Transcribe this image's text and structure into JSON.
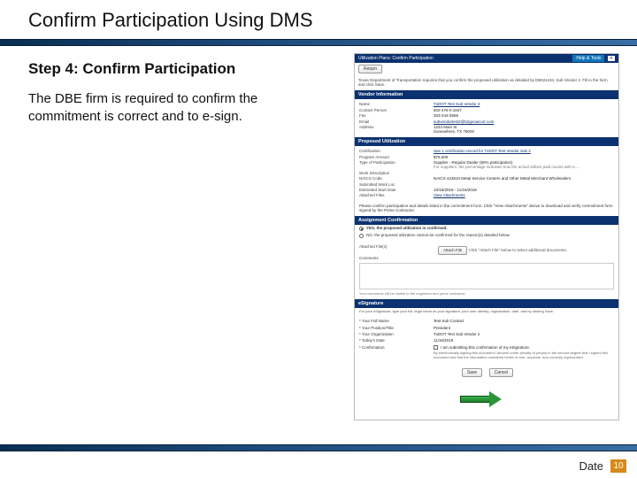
{
  "title": "Confirm Participation Using DMS",
  "step_heading": "Step 4: Confirm Participation",
  "step_body": "The DBE firm is required to confirm the commitment is correct and to e-sign.",
  "footer": {
    "date_label": "Date",
    "page": "10"
  },
  "ss": {
    "top_title": "Utilization Plans: Confirm Participation",
    "help": "Help & Tools",
    "close": "✕",
    "instr": "Texas Department of Transportation requires that you confirm the proposed utilization as detailed by DB021194. Sub Vendor 2. Fill in the form and click Save.",
    "return_btn": "Return",
    "vendor_section": "Vendor Information",
    "vendor_grid": {
      "name_l": "Name",
      "name_v": "TxDOT Test Sub Vendor 2",
      "contact_l": "Contact Person",
      "contact_v": "602-476-0.1847",
      "fax_l": "Fax",
      "fax_v": "303-444-5555",
      "email_l": "Email",
      "email_v": "subvendortest2@b2gnowcorr.com",
      "addr_l": "Address",
      "addr_v": "1234 Main St\nSomewhere, TX 79000"
    },
    "util_section": "Proposed Utilization",
    "util_grid": {
      "cert_l": "Certification",
      "cert_v": "See 1 certification record for TxDOT Test Vendor Sub 2",
      "pa_l": "Program Amount",
      "pa_v": "$75,000",
      "tp_l": "Type of Participation",
      "tp_v": "Supplier - Regular Dealer (60% participation)",
      "tp_note": "For suppliers, the percentage indicates how the actual dollars paid counts with a ...",
      "wd_l": "Work Description",
      "wd_v": "",
      "naics_l": "NAICS Code",
      "naics_v": "NAICS 423510   Metal Service Centers and Other Metal Merchant Wholesalers",
      "swl_l": "Submitted Work Loc",
      "swl_v": "",
      "est_l": "Estimated Start Date",
      "est_v": "10/16/2018   - 11/16/2018",
      "files_l": "Attached Files",
      "files_v": "View Attachments"
    },
    "confirm_note": "Please confirm participation and details listed in the commitment form. Click \"View Attachments\" above to download and verify commitment form signed by the Prime Contractor.",
    "ac_section": "Assignment Confirmation",
    "radio_yes": "YES, the proposed utilization is confirmed.",
    "radio_no": "NO, the proposed utilization cannot be confirmed for the reason(s) detailed below.",
    "attach_l": "Attached File(s)",
    "attach_btn": "Attach File",
    "attach_note": "Click \"Attach File\" below to select additional documents.",
    "comments_l": "Comments",
    "comments_note": "Your comments will be visible to the engineers and prime contractor.",
    "esig_section": "eSignature",
    "esig_instr": "For your eSignature, type your full, legal name as your signature, your user identity, organization, date, and by clicking Save.",
    "esig": {
      "name_l": "* Your Full Name",
      "name_v": "Test Sub Contact",
      "title_l": "* Your Position/Title",
      "title_v": "President",
      "org_l": "* Your Organization",
      "org_v": "TxDOT Test Sub Vendor 2",
      "date_l": "* Today's Date",
      "date_v": "11/16/2018",
      "conf_l": "* Confirmation",
      "conf_v": "I am submitting this confirmation of my eSignature.",
      "cb_note": "By electronically signing this document I declare under penalty of perjury in the second degree that I signed this document and that the information contained herein is true, accurate, and correctly represented."
    },
    "save_btn": "Save",
    "cancel_btn": "Cancel"
  }
}
